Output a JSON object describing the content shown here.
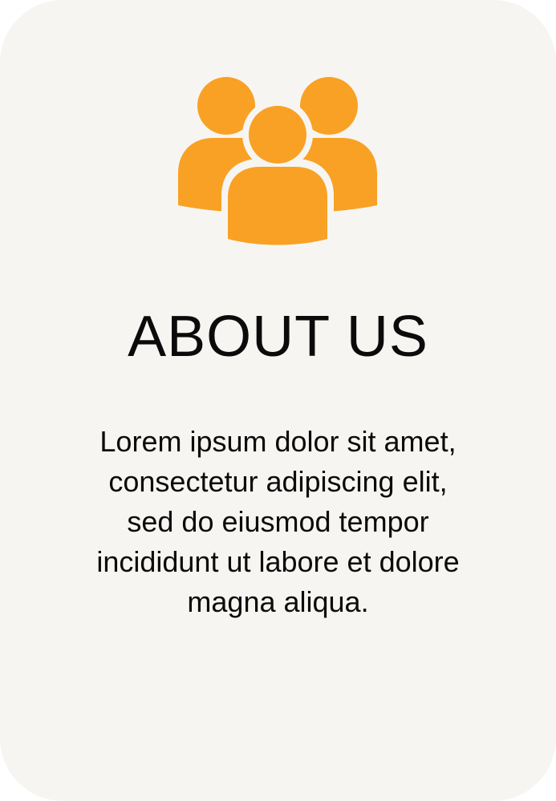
{
  "card": {
    "icon": "group-of-people-icon",
    "icon_color": "#F9A124",
    "background_color": "#F6F5F2",
    "title": "ABOUT US",
    "description_lines": [
      "Lorem ipsum dolor sit amet,",
      "consectetur adipiscing elit,",
      "sed do eiusmod tempor",
      "incididunt ut labore et dolore",
      "magna aliqua."
    ]
  }
}
